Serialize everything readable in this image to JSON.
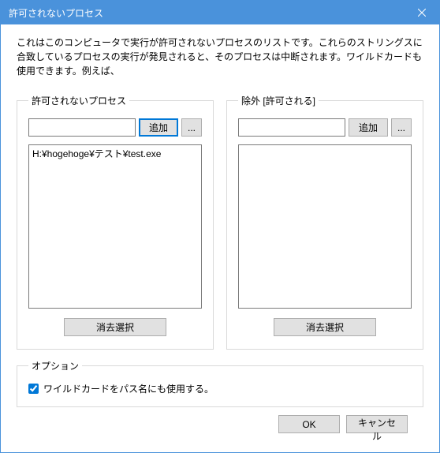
{
  "window": {
    "title": "許可されないプロセス"
  },
  "description": "これはこのコンピュータで実行が許可されないプロセスのリストです。これらのストリングスに合致しているプロセスの実行が発見されると、そのプロセスは中断されます。ワイルドカードも使用できます。例えば、",
  "left_panel": {
    "legend": "許可されないプロセス",
    "add_label": "追加",
    "ellipsis": "...",
    "items": [
      "H:¥hogehoge¥テスト¥test.exe"
    ],
    "clear_label": "消去選択"
  },
  "right_panel": {
    "legend": "除外 [許可される]",
    "add_label": "追加",
    "ellipsis": "...",
    "items": [],
    "clear_label": "消去選択"
  },
  "options": {
    "legend": "オプション",
    "wildcard_label": "ワイルドカードをパス名にも使用する。",
    "wildcard_checked": true
  },
  "footer": {
    "ok": "OK",
    "cancel": "キャンセル"
  }
}
